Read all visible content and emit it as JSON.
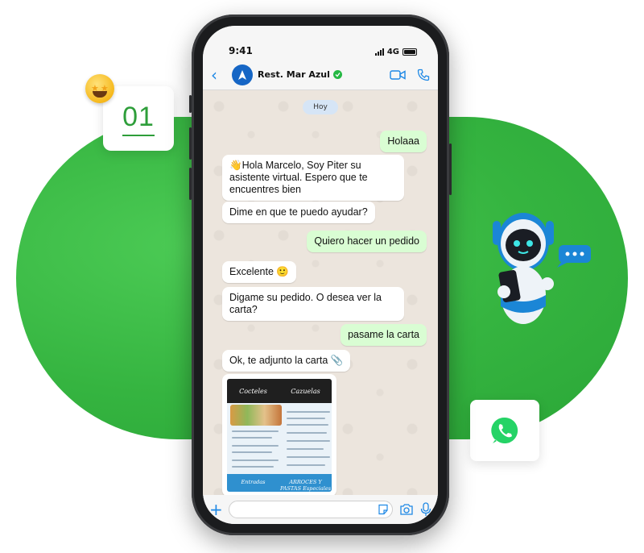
{
  "step": {
    "number": "01"
  },
  "status_bar": {
    "time": "9:41",
    "network": "4G"
  },
  "chat_header": {
    "contact_name": "Rest. Mar Azul"
  },
  "chat": {
    "day_label": "Hoy",
    "messages": [
      {
        "direction": "out",
        "text": "Holaaa"
      },
      {
        "direction": "in",
        "text": "👋Hola Marcelo, Soy Piter su asistente virtual. Espero que te encuentres bien"
      },
      {
        "direction": "in",
        "text": "Dime en que te puedo ayudar?"
      },
      {
        "direction": "out",
        "text": "Quiero hacer un pedido"
      },
      {
        "direction": "in",
        "text": "Excelente 🙂"
      },
      {
        "direction": "in",
        "text": "Digame su pedido. O desea ver la carta?"
      },
      {
        "direction": "out",
        "text": "pasame la carta"
      },
      {
        "direction": "in",
        "text": "Ok, te adjunto la carta 📎"
      }
    ],
    "menu_attachment": {
      "top_left": "Cocteles",
      "top_right": "Cazuelas",
      "bottom_left": "Entradas",
      "bottom_right": "ARROCES Y PASTAS Especiales"
    }
  },
  "colors": {
    "brand_green": "#35b440",
    "ios_blue": "#1e88e5",
    "outgoing_bubble": "#d9fdd3",
    "incoming_bubble": "#ffffff"
  },
  "icons": [
    "back-icon",
    "video-call-icon",
    "phone-call-icon",
    "verified-icon",
    "plus-icon",
    "sticker-icon",
    "camera-icon",
    "microphone-icon",
    "whatsapp-logo-icon",
    "robot-illustration",
    "star-struck-emoji-icon"
  ]
}
